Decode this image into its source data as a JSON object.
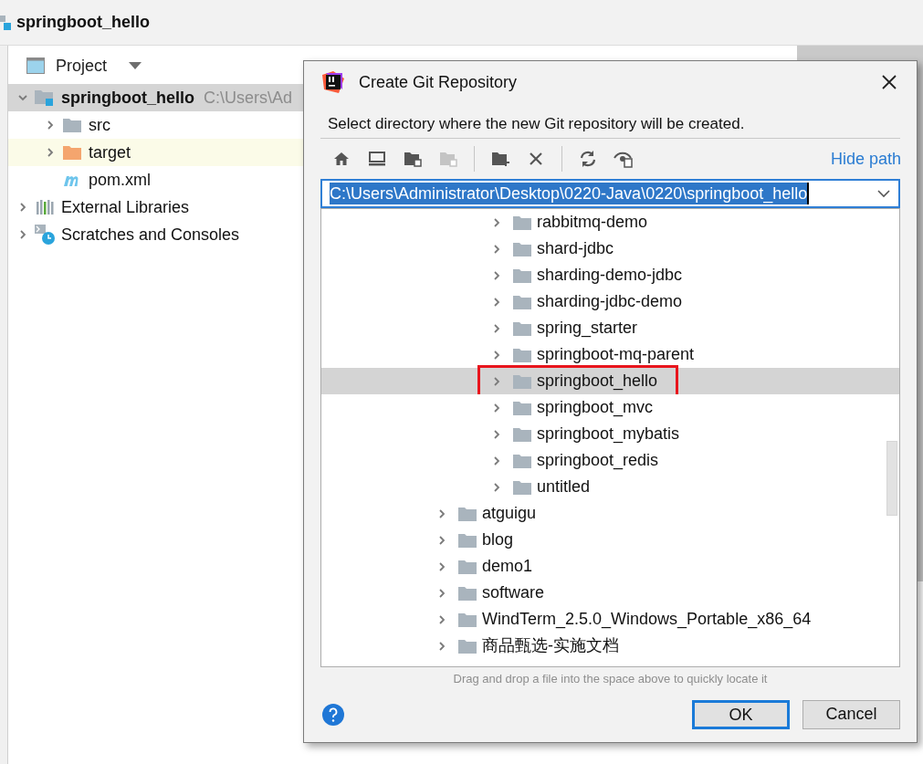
{
  "ide": {
    "title": "springboot_hello",
    "project_panel": {
      "label": "Project",
      "tree": [
        {
          "kind": "module",
          "label": "springboot_hello",
          "path": "C:\\Users\\Ad",
          "selected": true,
          "highlighted": false,
          "expanded": true,
          "children": [
            {
              "kind": "folder",
              "label": "src",
              "selected": false,
              "highlighted": false,
              "expanded": false
            },
            {
              "kind": "excluded",
              "label": "target",
              "selected": false,
              "highlighted": true,
              "expanded": false
            },
            {
              "kind": "maven",
              "label": "pom.xml",
              "selected": false,
              "highlighted": false
            }
          ]
        },
        {
          "kind": "libraries",
          "label": "External Libraries",
          "selected": false,
          "highlighted": false,
          "expanded": false
        },
        {
          "kind": "scratches",
          "label": "Scratches and Consoles",
          "selected": false,
          "highlighted": false,
          "expanded": false
        }
      ]
    }
  },
  "dialog": {
    "title": "Create Git Repository",
    "instruction": "Select directory where the new Git repository will be created.",
    "hide_path_link": "Hide path",
    "path_field": {
      "value": "C:\\Users\\Administrator\\Desktop\\0220-Java\\0220\\springboot_hello"
    },
    "tree": [
      {
        "children": [
          {
            "label": "rabbitmq-demo",
            "selected": false,
            "annotated": false
          },
          {
            "label": "shard-jdbc",
            "selected": false,
            "annotated": false
          },
          {
            "label": "sharding-demo-jdbc",
            "selected": false,
            "annotated": false
          },
          {
            "label": "sharding-jdbc-demo",
            "selected": false,
            "annotated": false
          },
          {
            "label": "spring_starter",
            "selected": false,
            "annotated": false
          },
          {
            "label": "springboot-mq-parent",
            "selected": false,
            "annotated": false
          },
          {
            "label": "springboot_hello",
            "selected": true,
            "annotated": true
          },
          {
            "label": "springboot_mvc",
            "selected": false,
            "annotated": false
          },
          {
            "label": "springboot_mybatis",
            "selected": false,
            "annotated": false
          },
          {
            "label": "springboot_redis",
            "selected": false,
            "annotated": false
          },
          {
            "label": "untitled",
            "selected": false,
            "annotated": false
          }
        ]
      },
      {
        "label": "atguigu",
        "selected": false,
        "annotated": false
      },
      {
        "label": "blog",
        "selected": false,
        "annotated": false
      },
      {
        "label": "demo1",
        "selected": false,
        "annotated": false
      },
      {
        "label": "software",
        "selected": false,
        "annotated": false
      },
      {
        "label": "WindTerm_2.5.0_Windows_Portable_x86_64",
        "selected": false,
        "annotated": false
      },
      {
        "label": "商品甄选-实施文档",
        "selected": false,
        "annotated": false
      }
    ],
    "hint": "Drag and drop a file into the space above to quickly locate it",
    "buttons": [
      {
        "kind": "primary",
        "label": "OK"
      },
      {
        "kind": "secondary",
        "label": "Cancel"
      }
    ]
  }
}
